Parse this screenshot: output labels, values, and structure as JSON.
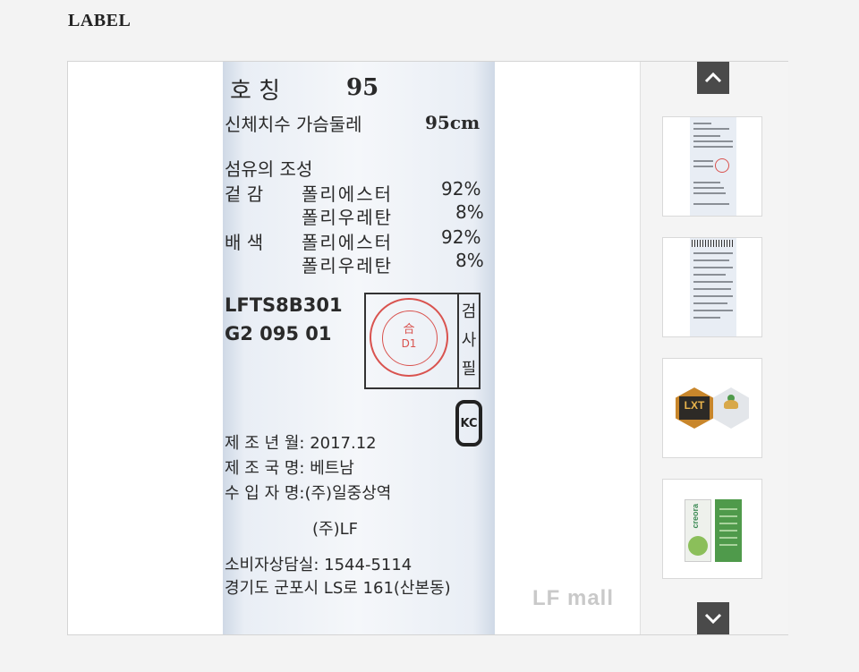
{
  "section": {
    "title": "LABEL"
  },
  "label": {
    "hoching": "호 칭",
    "size": "95",
    "chest_label": "신체치수 가슴둘레",
    "chest_value": "95cm",
    "fiber_title": "섬유의 조성",
    "rows": [
      {
        "group": "겉 감",
        "material": "폴리에스터",
        "percent": "92%"
      },
      {
        "group": "",
        "material": "폴리우레탄",
        "percent": "8%"
      },
      {
        "group": "배 색",
        "material": "폴리에스터",
        "percent": "92%"
      },
      {
        "group": "",
        "material": "폴리우레탄",
        "percent": "8%"
      }
    ],
    "code1": "LFTS8B301",
    "code2": "G2 095 01",
    "stamp": {
      "mark": "合",
      "code": "D1"
    },
    "inspect": "검사필",
    "kc": "KC",
    "mfg_date": "제 조 년 월: 2017.12",
    "country": "제 조 국 명: 베트남",
    "importer": "수 입 자 명:(주)일중상역",
    "brand": "(주)LF",
    "phone": "소비자상담실: 1544-5114",
    "address": "경기도 군포시 LS로 161(산본동)"
  },
  "watermark": "LF mall",
  "thumbnails": {
    "mini_logo": "LXT",
    "mini_brand": "creora",
    "items": [
      {
        "name": "thumb-label-front"
      },
      {
        "name": "thumb-label-back"
      },
      {
        "name": "thumb-hex-tags"
      },
      {
        "name": "thumb-creora-tags"
      }
    ]
  },
  "icons": {
    "up": "chevron-up-icon",
    "down": "chevron-down-icon"
  },
  "colors": {
    "background": "#f3f3f3",
    "arrow_button": "#4a4a4a",
    "stamp_red": "#d9534f"
  }
}
